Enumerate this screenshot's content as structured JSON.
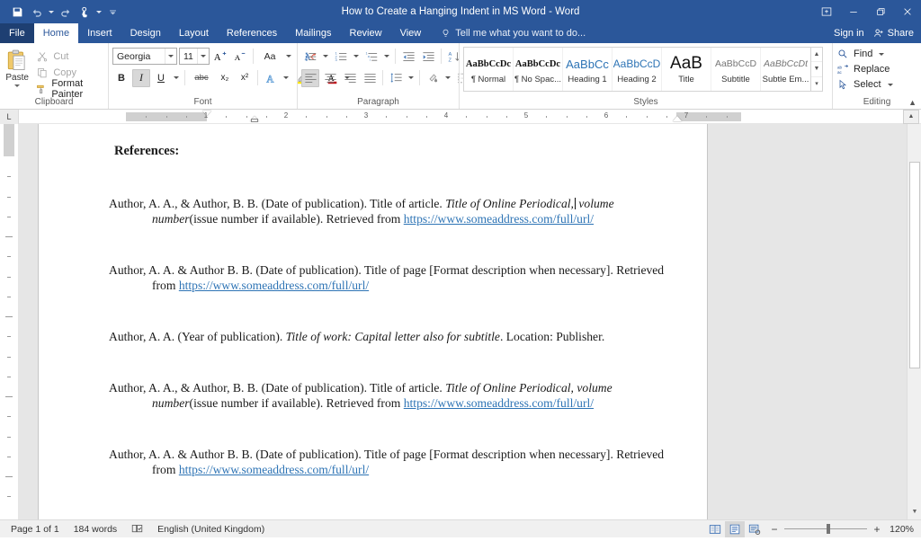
{
  "window": {
    "title": "How to Create a Hanging Indent in MS Word - Word",
    "quick_access": [
      {
        "name": "save-icon",
        "label": "Save"
      },
      {
        "name": "undo-icon",
        "label": "Undo"
      },
      {
        "name": "redo-icon",
        "label": "Redo"
      },
      {
        "name": "touch-mode-icon",
        "label": "Touch/Mouse Mode"
      },
      {
        "name": "customize-qat-icon",
        "label": "Customize Quick Access Toolbar"
      }
    ],
    "controls": {
      "ribbon_display": "Ribbon Display Options",
      "minimize": "Minimize",
      "restore": "Restore Down",
      "close": "Close"
    }
  },
  "tabs": [
    {
      "label": "File",
      "active": false
    },
    {
      "label": "Home",
      "active": true
    },
    {
      "label": "Insert",
      "active": false
    },
    {
      "label": "Design",
      "active": false
    },
    {
      "label": "Layout",
      "active": false
    },
    {
      "label": "References",
      "active": false
    },
    {
      "label": "Mailings",
      "active": false
    },
    {
      "label": "Review",
      "active": false
    },
    {
      "label": "View",
      "active": false
    }
  ],
  "tell_me": {
    "placeholder": "Tell me what you want to do..."
  },
  "account": {
    "sign_in": "Sign in",
    "share": "Share"
  },
  "ribbon": {
    "clipboard": {
      "group_label": "Clipboard",
      "paste": "Paste",
      "cut": "Cut",
      "copy": "Copy",
      "format_painter": "Format Painter"
    },
    "font": {
      "group_label": "Font",
      "font_name": "Georgia",
      "font_size": "11",
      "grow_font": "A",
      "shrink_font": "A",
      "change_case": "Aa",
      "clear_formatting": "Clear All Formatting",
      "bold": "B",
      "italic": "I",
      "underline": "U",
      "strikethrough": "abc",
      "subscript": "x₂",
      "superscript": "x²",
      "text_effects": "A",
      "text_highlight": "ab",
      "font_color": "A",
      "italic_active": true
    },
    "paragraph": {
      "group_label": "Paragraph",
      "bullets": "Bullets",
      "numbering": "Numbering",
      "multilevel_list": "Multilevel List",
      "decrease_indent": "Decrease Indent",
      "increase_indent": "Increase Indent",
      "sort": "Sort",
      "show_marks": "¶",
      "align_left": "Align Left",
      "align_center": "Center",
      "align_right": "Align Right",
      "justify": "Justify",
      "line_spacing": "Line and Paragraph Spacing",
      "shading": "Shading",
      "borders": "Borders",
      "align_left_active": true
    },
    "styles": {
      "group_label": "Styles",
      "items": [
        {
          "preview": "AaBbCcDc",
          "name": "Normal",
          "mark": "¶ "
        },
        {
          "preview": "AaBbCcDc",
          "name": "No Spac...",
          "mark": "¶ "
        },
        {
          "preview": "AaBbCc",
          "name": "Heading 1",
          "mark": ""
        },
        {
          "preview": "AaBbCcD",
          "name": "Heading 2",
          "mark": ""
        },
        {
          "preview": "AaB",
          "name": "Title",
          "mark": ""
        },
        {
          "preview": "AaBbCcD",
          "name": "Subtitle",
          "mark": ""
        },
        {
          "preview": "AaBbCcDt",
          "name": "Subtle Em...",
          "mark": ""
        }
      ]
    },
    "editing": {
      "group_label": "Editing",
      "find": "Find",
      "replace": "Replace",
      "select": "Select"
    },
    "collapse": "Collapse the Ribbon"
  },
  "ruler": {
    "tab_selector": "L",
    "horizontal_numbers": [
      "1",
      "2",
      "3",
      "4",
      "5",
      "6",
      "7"
    ],
    "unit": "inches"
  },
  "document": {
    "heading": "References:",
    "references": [
      {
        "parts": [
          {
            "t": "Author, A. A., & Author, B. B. (Date of publication). Title of article. ",
            "style": "normal"
          },
          {
            "t": "Title of Online Periodical,",
            "style": "italic"
          },
          {
            "t": " ",
            "style": "normal"
          },
          {
            "t": "volume number",
            "style": "italic"
          },
          {
            "t": "(issue number if available). Retrieved from ",
            "style": "normal"
          },
          {
            "t": "https://www.someaddress.com/full/url/",
            "style": "link"
          }
        ],
        "has_caret": true
      },
      {
        "parts": [
          {
            "t": "Author, A. A. & Author B. B. (Date of publication). Title of page [Format description when necessary]. Retrieved from ",
            "style": "normal"
          },
          {
            "t": "https://www.someaddress.com/full/url/",
            "style": "link"
          }
        ],
        "has_caret": false
      },
      {
        "parts": [
          {
            "t": "Author, A. A. (Year of publication). ",
            "style": "normal"
          },
          {
            "t": "Title of work: Capital letter also for subtitle",
            "style": "italic"
          },
          {
            "t": ". Location: Publisher.",
            "style": "normal"
          }
        ],
        "has_caret": false
      },
      {
        "parts": [
          {
            "t": "Author, A. A., & Author, B. B. (Date of publication). Title of article. ",
            "style": "normal"
          },
          {
            "t": "Title of Online Periodical,",
            "style": "italic"
          },
          {
            "t": " ",
            "style": "normal"
          },
          {
            "t": "volume number",
            "style": "italic"
          },
          {
            "t": "(issue number if available). Retrieved from ",
            "style": "normal"
          },
          {
            "t": "https://www.someaddress.com/full/url/",
            "style": "link"
          }
        ],
        "has_caret": false
      },
      {
        "parts": [
          {
            "t": "Author, A. A. & Author B. B. (Date of publication). Title of page [Format description when necessary]. Retrieved from ",
            "style": "normal"
          },
          {
            "t": "https://www.someaddress.com/full/url/",
            "style": "link"
          }
        ],
        "has_caret": false
      }
    ]
  },
  "status_bar": {
    "page": "Page 1 of 1",
    "words": "184 words",
    "proofing": "Proofing errors icon",
    "language": "English (United Kingdom)",
    "views": [
      {
        "name": "read-mode",
        "selected": false
      },
      {
        "name": "print-layout",
        "selected": true
      },
      {
        "name": "web-layout",
        "selected": false
      }
    ],
    "zoom_out": "−",
    "zoom_in": "+",
    "zoom_level": "120%"
  },
  "colors": {
    "word_blue": "#2b579a",
    "file_tab": "#1e3f72",
    "link": "#2e74b5",
    "canvas_grey": "#e6e6e6",
    "status_grey": "#f0f0f0"
  }
}
